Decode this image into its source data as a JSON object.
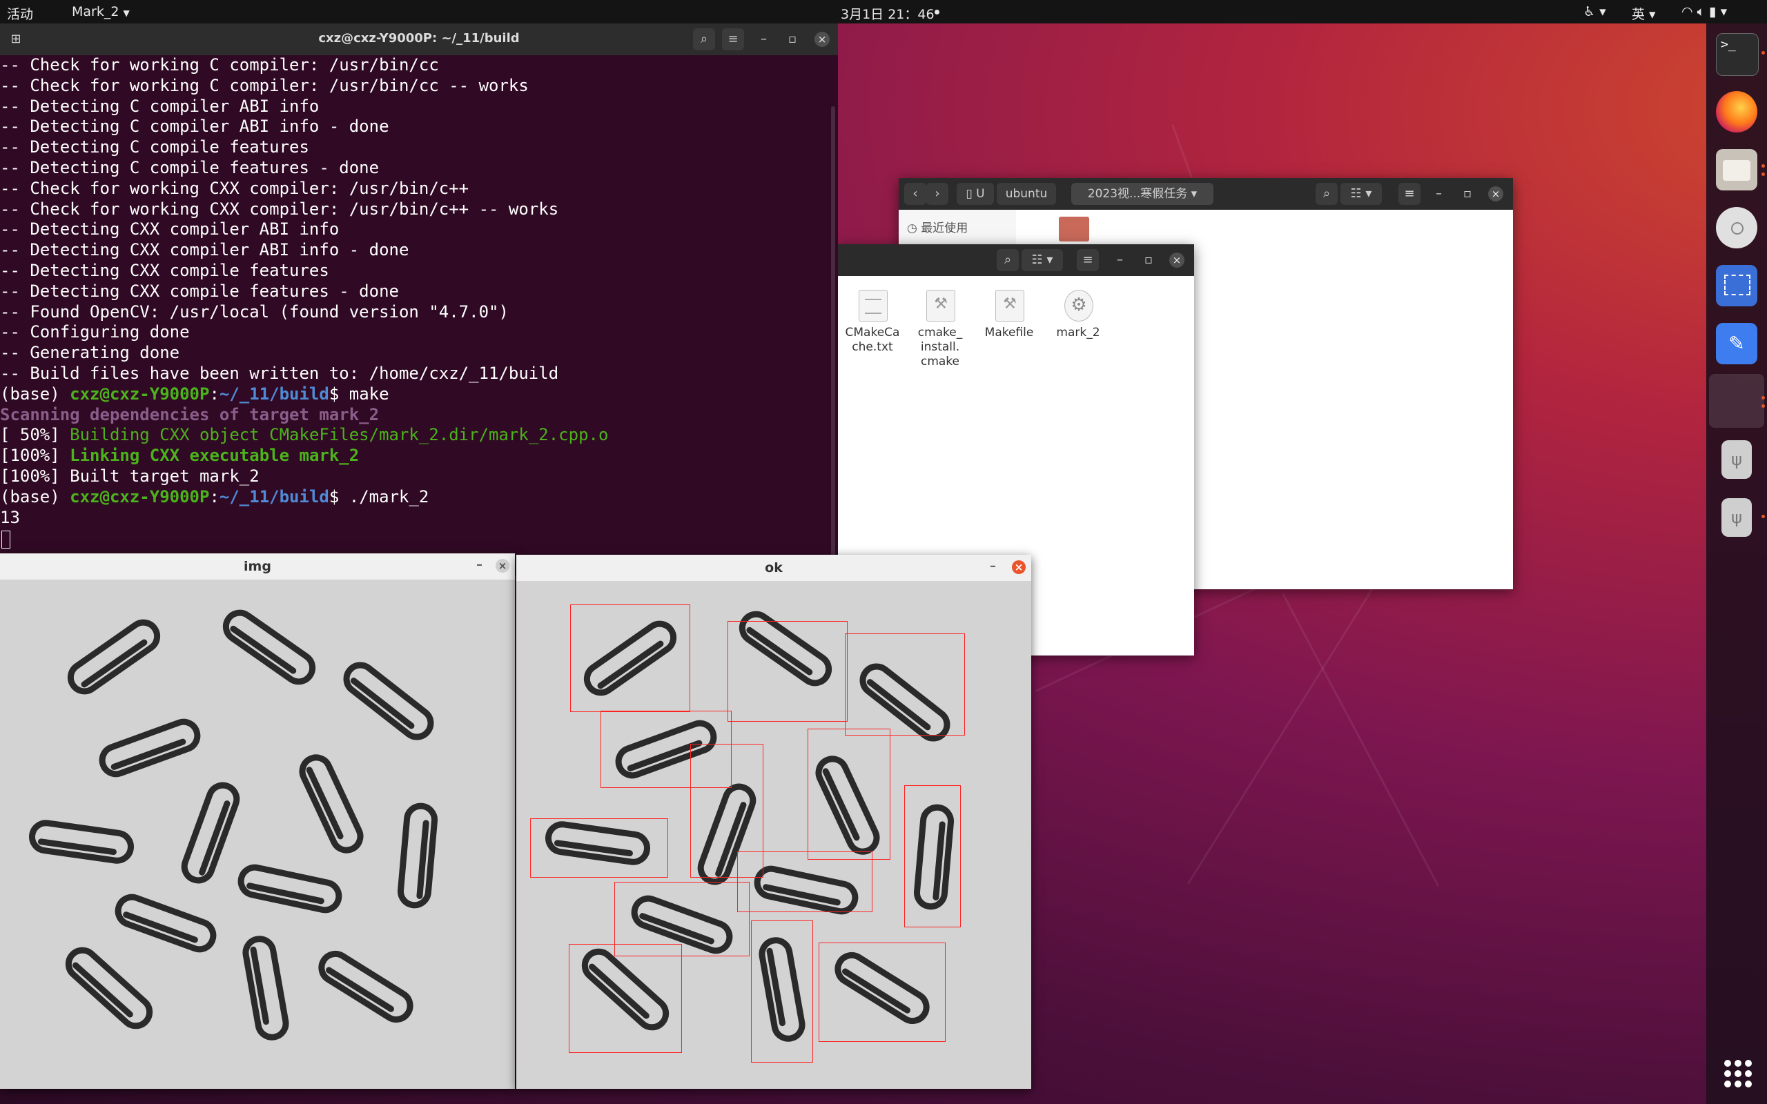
{
  "topbar": {
    "activities": "活动",
    "app_menu": "Mark_2",
    "clock": "3月1日 21：46",
    "input_method": "英"
  },
  "terminal": {
    "title": "cxz@cxz-Y9000P: ~/_11/build",
    "lines": [
      "-- Check for working C compiler: /usr/bin/cc",
      "-- Check for working C compiler: /usr/bin/cc -- works",
      "-- Detecting C compiler ABI info",
      "-- Detecting C compiler ABI info - done",
      "-- Detecting C compile features",
      "-- Detecting C compile features - done",
      "-- Check for working CXX compiler: /usr/bin/c++",
      "-- Check for working CXX compiler: /usr/bin/c++ -- works",
      "-- Detecting CXX compiler ABI info",
      "-- Detecting CXX compiler ABI info - done",
      "-- Detecting CXX compile features",
      "-- Detecting CXX compile features - done",
      "-- Found OpenCV: /usr/local (found version \"4.7.0\")",
      "-- Configuring done",
      "-- Generating done",
      "-- Build files have been written to: /home/cxz/_11/build"
    ],
    "prompt_prefix": "(base) ",
    "prompt_user": "cxz@cxz-Y9000P",
    "prompt_colon": ":",
    "prompt_path": "~/_11/build",
    "prompt_dollar": "$ ",
    "cmd1": "make",
    "scan_line": "Scanning dependencies of target mark_2",
    "build_pct": "[ 50%] ",
    "build_text": "Building CXX object CMakeFiles/mark_2.dir/mark_2.cpp.o",
    "link_pct": "[100%] ",
    "link_text": "Linking CXX executable mark_2",
    "built_line": "[100%] Built target mark_2",
    "cmd2": "./mark_2",
    "output": "13"
  },
  "file_manager_back": {
    "path_u": "U",
    "path_ubuntu": "ubuntu",
    "path_folder": "2023视...寒假任务",
    "sidebar_recent": "最近使用"
  },
  "file_manager_front": {
    "files": [
      {
        "name": "CMakeCa che.txt",
        "icon": "text-file-icon"
      },
      {
        "name": "cmake_ install. cmake",
        "icon": "script-file-icon"
      },
      {
        "name": "Makefile",
        "icon": "script-file-icon"
      },
      {
        "name": "mark_2",
        "icon": "executable-gear-icon"
      }
    ]
  },
  "img_window": {
    "title": "img"
  },
  "ok_window": {
    "title": "ok"
  },
  "detection_count": 13,
  "colors": {
    "terminal_bg": "#300a24",
    "prompt_green": "#4bb31b",
    "prompt_blue": "#4f8bd6",
    "close_orange": "#e9542c",
    "box_red": "#ff2222"
  }
}
